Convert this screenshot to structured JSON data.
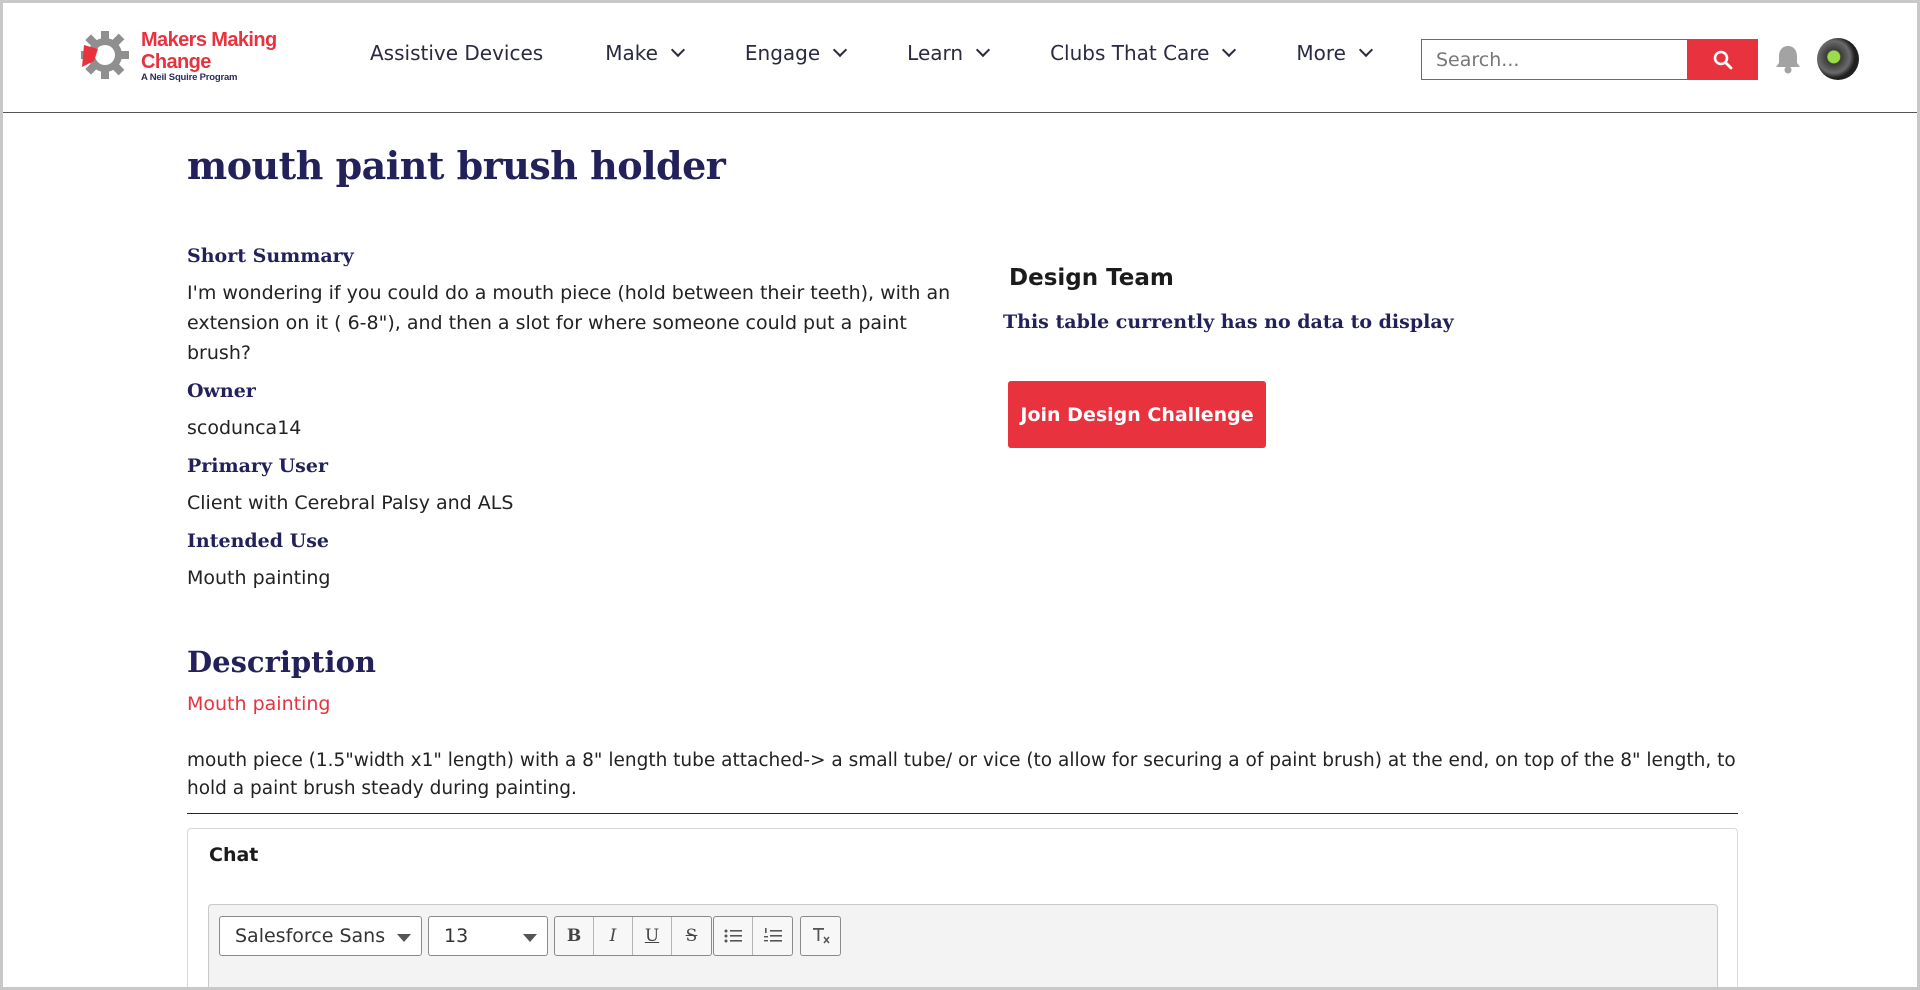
{
  "header": {
    "logo": {
      "line1": "Makers Making",
      "line2": "Change",
      "tagline": "A Neil Squire Program"
    },
    "nav": [
      {
        "label": "Assistive Devices",
        "dropdown": false
      },
      {
        "label": "Make",
        "dropdown": true
      },
      {
        "label": "Engage",
        "dropdown": true
      },
      {
        "label": "Learn",
        "dropdown": true
      },
      {
        "label": "Clubs That Care",
        "dropdown": true
      },
      {
        "label": "More",
        "dropdown": true
      }
    ],
    "search": {
      "placeholder": "Search..."
    }
  },
  "page": {
    "title": "mouth paint brush holder",
    "short_summary_label": "Short Summary",
    "short_summary_line1": "I'm wondering if you could do a mouth piece (hold between their teeth), with an",
    "short_summary_line2": "extension on it ( 6-8\"), and then a slot for where someone could put a paint",
    "short_summary_line3": "brush?",
    "owner_label": "Owner",
    "owner": "scodunca14",
    "primary_user_label": "Primary User",
    "primary_user": "Client with Cerebral Palsy and ALS",
    "intended_use_label": "Intended Use",
    "intended_use": "Mouth painting"
  },
  "design_team": {
    "title": "Design Team",
    "empty_message": "This table currently has no data to display",
    "join_button": "Join Design Challenge"
  },
  "description": {
    "title": "Description",
    "subtitle": "Mouth painting",
    "body": "mouth piece (1.5\"width x1\" length) with a 8\" length tube attached-> a small tube/ or vice (to allow for securing a of paint brush) at the end, on top of the 8\" length, to hold a paint brush steady during painting."
  },
  "chat": {
    "title": "Chat",
    "font_family_value": "Salesforce Sans",
    "font_size_value": "13",
    "format_buttons": [
      "B",
      "I",
      "U",
      "S"
    ],
    "list_buttons": [
      "bulleted-list",
      "numbered-list"
    ],
    "clear_button": "Tx"
  },
  "colors": {
    "brand_red": "#e8333f",
    "navy": "#23215a"
  }
}
